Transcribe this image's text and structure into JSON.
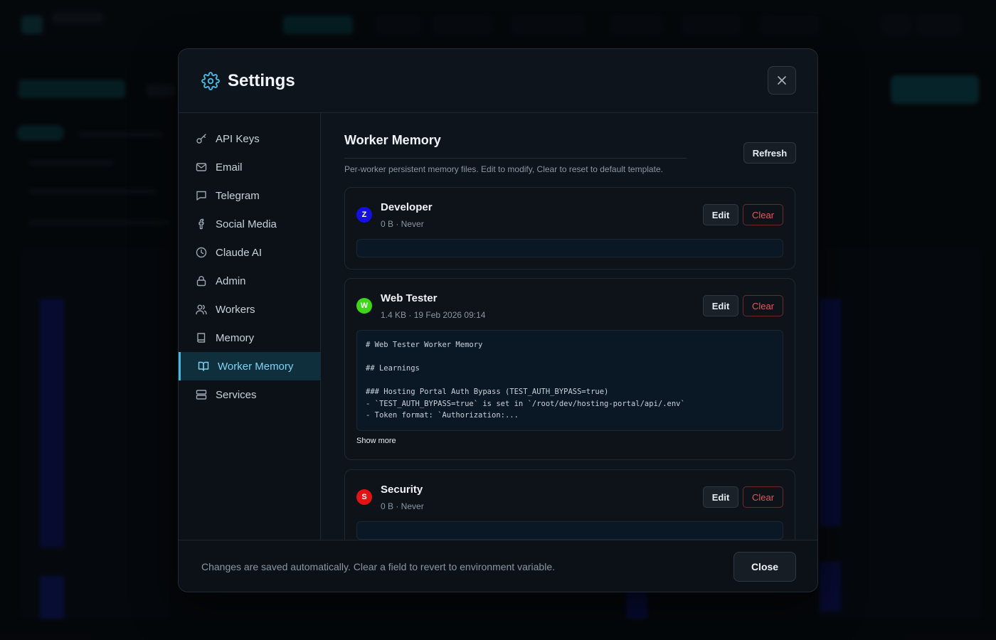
{
  "modal": {
    "title": "Settings",
    "close_icon": "close-icon"
  },
  "sidebar": {
    "items": [
      {
        "label": "API Keys",
        "icon": "key-icon"
      },
      {
        "label": "Email",
        "icon": "mail-icon"
      },
      {
        "label": "Telegram",
        "icon": "message-icon"
      },
      {
        "label": "Social Media",
        "icon": "facebook-icon"
      },
      {
        "label": "Claude AI",
        "icon": "clock-icon"
      },
      {
        "label": "Admin",
        "icon": "lock-icon"
      },
      {
        "label": "Workers",
        "icon": "users-icon"
      },
      {
        "label": "Memory",
        "icon": "book-icon"
      },
      {
        "label": "Worker Memory",
        "icon": "open-book-icon",
        "active": true
      },
      {
        "label": "Services",
        "icon": "server-icon"
      }
    ]
  },
  "content": {
    "title": "Worker Memory",
    "description": "Per-worker persistent memory files. Edit to modify, Clear to reset to default template.",
    "refresh_label": "Refresh",
    "edit_label": "Edit",
    "clear_label": "Clear",
    "show_more_label": "Show more",
    "workers": [
      {
        "initial": "Z",
        "name": "Developer",
        "meta": "0 B · Never",
        "color": "#1410e0",
        "memory": ""
      },
      {
        "initial": "W",
        "name": "Web Tester",
        "meta": "1.4 KB · 19 Feb 2026 09:14",
        "color": "#3fd61a",
        "memory": "# Web Tester Worker Memory\n\n## Learnings\n\n### Hosting Portal Auth Bypass (TEST_AUTH_BYPASS=true)\n- `TEST_AUTH_BYPASS=true` is set in `/root/dev/hosting-portal/api/.env`\n- Token format: `Authorization:..."
      },
      {
        "initial": "S",
        "name": "Security",
        "meta": "0 B · Never",
        "color": "#e01414",
        "memory": ""
      }
    ]
  },
  "footer": {
    "text": "Changes are saved automatically. Clear a field to revert to environment variable.",
    "close_label": "Close"
  },
  "colors": {
    "accent": "#49b6e0",
    "danger": "#e2575f",
    "background": "#0e141b"
  }
}
